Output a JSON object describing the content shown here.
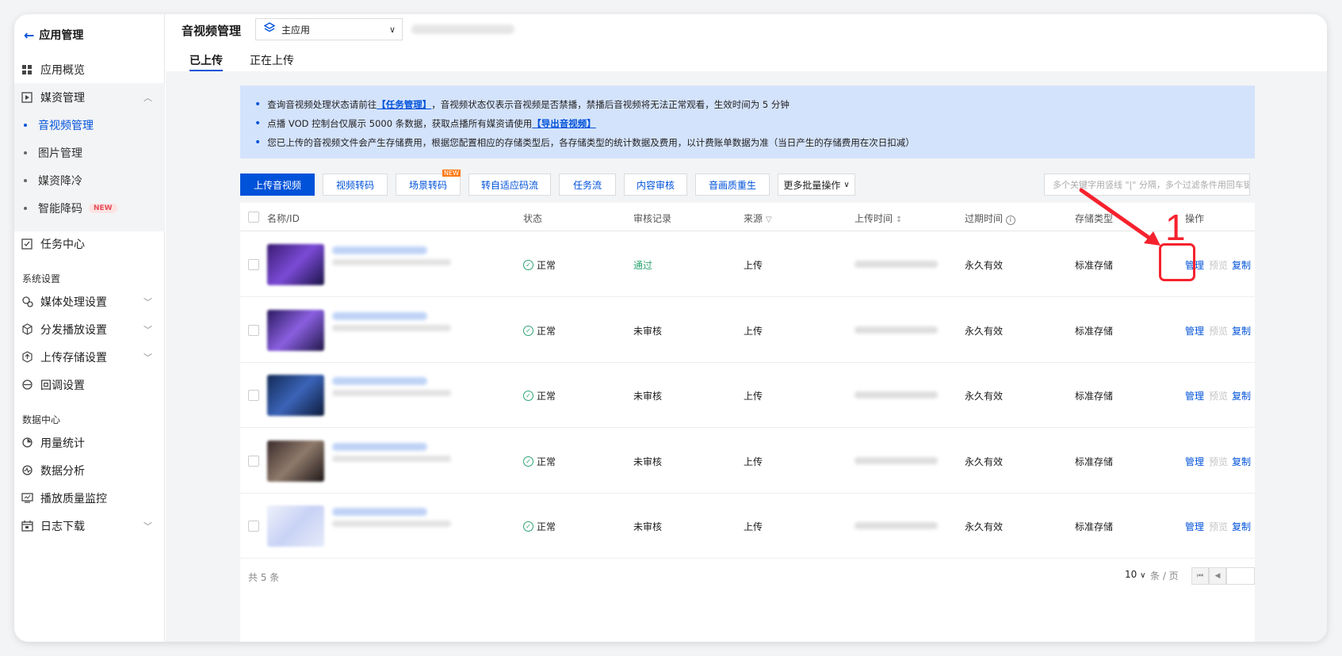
{
  "sidebar": {
    "header": "应用管理",
    "overview": "应用概览",
    "media": "媒资管理",
    "media_sub": [
      {
        "label": "音视频管理"
      },
      {
        "label": "图片管理"
      },
      {
        "label": "媒资降冷"
      },
      {
        "label": "智能降码",
        "badge": "NEW"
      }
    ],
    "task_center": "任务中心",
    "section_system": "系统设置",
    "system_items": [
      "媒体处理设置",
      "分发播放设置",
      "上传存储设置",
      "回调设置"
    ],
    "section_data": "数据中心",
    "data_items": [
      "用量统计",
      "数据分析",
      "播放质量监控",
      "日志下载"
    ]
  },
  "topbar": {
    "title": "音视频管理",
    "app_select": "主应用",
    "tabs": [
      "已上传",
      "正在上传"
    ]
  },
  "notice": {
    "line1_a": "查询音视频处理状态请前往",
    "line1_link": "【任务管理】",
    "line1_b": "，音视频状态仅表示音视频是否禁播，禁播后音视频将无法正常观看，生效时间为 5 分钟",
    "line2_a": "点播 VOD 控制台仅展示 5000 条数据，获取点播所有媒资请使用",
    "line2_link": "【导出音视频】",
    "line3": "您已上传的音视频文件会产生存储费用，根据您配置相应的存储类型后，各存储类型的统计数据及费用，以计费账单数据为准（当日产生的存储费用在次日扣减）"
  },
  "toolbar": {
    "upload": "上传音视频",
    "transcode": "视频转码",
    "scene": "场景转码",
    "scene_tag": "NEW",
    "adaptive": "转自适应码流",
    "workflow": "任务流",
    "review": "内容审核",
    "quality": "音画质重生",
    "more": "更多批量操作",
    "search_placeholder": "多个关键字用竖线 \"|\" 分隔，多个过滤条件用回车键分隔"
  },
  "table": {
    "headers": {
      "name": "名称/ID",
      "status": "状态",
      "review": "审核记录",
      "source": "来源",
      "upload_time": "上传时间",
      "expire": "过期时间",
      "storage": "存储类型",
      "actions": "操作"
    },
    "rows": [
      {
        "status": "正常",
        "review": "通过",
        "source": "上传",
        "expire": "永久有效",
        "storage": "标准存储"
      },
      {
        "status": "正常",
        "review": "未审核",
        "source": "上传",
        "expire": "永久有效",
        "storage": "标准存储"
      },
      {
        "status": "正常",
        "review": "未审核",
        "source": "上传",
        "expire": "永久有效",
        "storage": "标准存储"
      },
      {
        "status": "正常",
        "review": "未审核",
        "source": "上传",
        "expire": "永久有效",
        "storage": "标准存储"
      },
      {
        "status": "正常",
        "review": "未审核",
        "source": "上传",
        "expire": "永久有效",
        "storage": "标准存储"
      }
    ],
    "action_labels": {
      "manage": "管理",
      "preview": "预览",
      "copy": "复制"
    },
    "footer": {
      "count": "共 5 条",
      "page_size": "10",
      "page_unit": "条 / 页"
    }
  },
  "annotation": {
    "number": "1",
    "color": "#f5222d"
  },
  "colors": {
    "accent": "#0052d9",
    "success": "#2ba471",
    "notice_bg": "#d4e3fc"
  }
}
